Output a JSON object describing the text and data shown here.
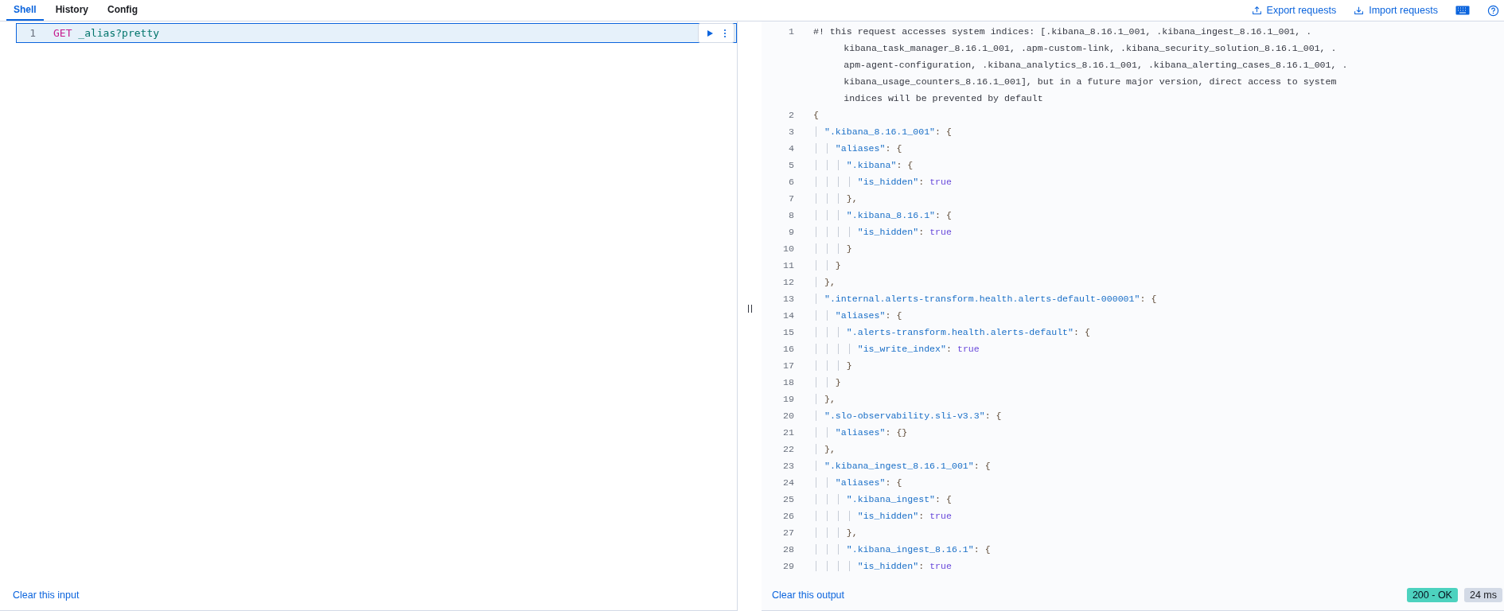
{
  "tabs": [
    {
      "label": "Shell",
      "selected": true
    },
    {
      "label": "History",
      "selected": false
    },
    {
      "label": "Config",
      "selected": false
    }
  ],
  "header_actions": [
    {
      "kind": "export",
      "label": "Export requests"
    },
    {
      "kind": "import",
      "label": "Import requests"
    },
    {
      "kind": "keyboard"
    },
    {
      "kind": "help"
    }
  ],
  "input": {
    "lines": [
      {
        "number": "1",
        "tokens": [
          {
            "kind": "method",
            "text": "GET"
          },
          {
            "kind": "path",
            "text": " _alias?pretty"
          }
        ]
      }
    ],
    "footer_link": "Clear this input"
  },
  "output": {
    "lines": [
      {
        "number": "1",
        "segments": [
          "#! this request accesses system indices: [.kibana_8.16.1_001, .kibana_ingest_8.16.1_001, .",
          "kibana_task_manager_8.16.1_001, .apm-custom-link, .kibana_security_solution_8.16.1_001, .",
          "apm-agent-configuration, .kibana_analytics_8.16.1_001, .kibana_alerting_cases_8.16.1_001, .",
          "kibana_usage_counters_8.16.1_001], but in a future major version, direct access to system",
          "indices will be prevented by default"
        ]
      },
      {
        "number": "2",
        "tokens": [
          {
            "kind": "punct",
            "text": "{"
          }
        ]
      },
      {
        "number": "3",
        "tokens": [
          {
            "kind": "key",
            "text": "  \".kibana_8.16.1_001\""
          },
          {
            "kind": "punct",
            "text": ": {"
          }
        ]
      },
      {
        "number": "4",
        "tokens": [
          {
            "kind": "key",
            "text": "    \"aliases\""
          },
          {
            "kind": "punct",
            "text": ": {"
          }
        ]
      },
      {
        "number": "5",
        "tokens": [
          {
            "kind": "key",
            "text": "      \".kibana\""
          },
          {
            "kind": "punct",
            "text": ": {"
          }
        ]
      },
      {
        "number": "6",
        "tokens": [
          {
            "kind": "key",
            "text": "        \"is_hidden\""
          },
          {
            "kind": "punct",
            "text": ": "
          },
          {
            "kind": "bool",
            "text": "true"
          }
        ]
      },
      {
        "number": "7",
        "tokens": [
          {
            "kind": "punct",
            "text": "      },"
          }
        ]
      },
      {
        "number": "8",
        "tokens": [
          {
            "kind": "key",
            "text": "      \".kibana_8.16.1\""
          },
          {
            "kind": "punct",
            "text": ": {"
          }
        ]
      },
      {
        "number": "9",
        "tokens": [
          {
            "kind": "key",
            "text": "        \"is_hidden\""
          },
          {
            "kind": "punct",
            "text": ": "
          },
          {
            "kind": "bool",
            "text": "true"
          }
        ]
      },
      {
        "number": "10",
        "tokens": [
          {
            "kind": "punct",
            "text": "      }"
          }
        ]
      },
      {
        "number": "11",
        "tokens": [
          {
            "kind": "punct",
            "text": "    }"
          }
        ]
      },
      {
        "number": "12",
        "tokens": [
          {
            "kind": "punct",
            "text": "  },"
          }
        ]
      },
      {
        "number": "13",
        "tokens": [
          {
            "kind": "key",
            "text": "  \".internal.alerts-transform.health.alerts-default-000001\""
          },
          {
            "kind": "punct",
            "text": ": {"
          }
        ]
      },
      {
        "number": "14",
        "tokens": [
          {
            "kind": "key",
            "text": "    \"aliases\""
          },
          {
            "kind": "punct",
            "text": ": {"
          }
        ]
      },
      {
        "number": "15",
        "tokens": [
          {
            "kind": "key",
            "text": "      \".alerts-transform.health.alerts-default\""
          },
          {
            "kind": "punct",
            "text": ": {"
          }
        ]
      },
      {
        "number": "16",
        "tokens": [
          {
            "kind": "key",
            "text": "        \"is_write_index\""
          },
          {
            "kind": "punct",
            "text": ": "
          },
          {
            "kind": "bool",
            "text": "true"
          }
        ]
      },
      {
        "number": "17",
        "tokens": [
          {
            "kind": "punct",
            "text": "      }"
          }
        ]
      },
      {
        "number": "18",
        "tokens": [
          {
            "kind": "punct",
            "text": "    }"
          }
        ]
      },
      {
        "number": "19",
        "tokens": [
          {
            "kind": "punct",
            "text": "  },"
          }
        ]
      },
      {
        "number": "20",
        "tokens": [
          {
            "kind": "key",
            "text": "  \".slo-observability.sli-v3.3\""
          },
          {
            "kind": "punct",
            "text": ": {"
          }
        ]
      },
      {
        "number": "21",
        "tokens": [
          {
            "kind": "key",
            "text": "    \"aliases\""
          },
          {
            "kind": "punct",
            "text": ": {}"
          }
        ]
      },
      {
        "number": "22",
        "tokens": [
          {
            "kind": "punct",
            "text": "  },"
          }
        ]
      },
      {
        "number": "23",
        "tokens": [
          {
            "kind": "key",
            "text": "  \".kibana_ingest_8.16.1_001\""
          },
          {
            "kind": "punct",
            "text": ": {"
          }
        ]
      },
      {
        "number": "24",
        "tokens": [
          {
            "kind": "key",
            "text": "    \"aliases\""
          },
          {
            "kind": "punct",
            "text": ": {"
          }
        ]
      },
      {
        "number": "25",
        "tokens": [
          {
            "kind": "key",
            "text": "      \".kibana_ingest\""
          },
          {
            "kind": "punct",
            "text": ": {"
          }
        ]
      },
      {
        "number": "26",
        "tokens": [
          {
            "kind": "key",
            "text": "        \"is_hidden\""
          },
          {
            "kind": "punct",
            "text": ": "
          },
          {
            "kind": "bool",
            "text": "true"
          }
        ]
      },
      {
        "number": "27",
        "tokens": [
          {
            "kind": "punct",
            "text": "      },"
          }
        ]
      },
      {
        "number": "28",
        "tokens": [
          {
            "kind": "key",
            "text": "      \".kibana_ingest_8.16.1\""
          },
          {
            "kind": "punct",
            "text": ": {"
          }
        ]
      },
      {
        "number": "29",
        "tokens": [
          {
            "kind": "key",
            "text": "        \"is_hidden\""
          },
          {
            "kind": "punct",
            "text": ": "
          },
          {
            "kind": "bool",
            "text": "true"
          }
        ]
      }
    ],
    "footer_link": "Clear this output",
    "status": {
      "kind": "success",
      "label": "200 - OK"
    },
    "duration": "24 ms"
  }
}
